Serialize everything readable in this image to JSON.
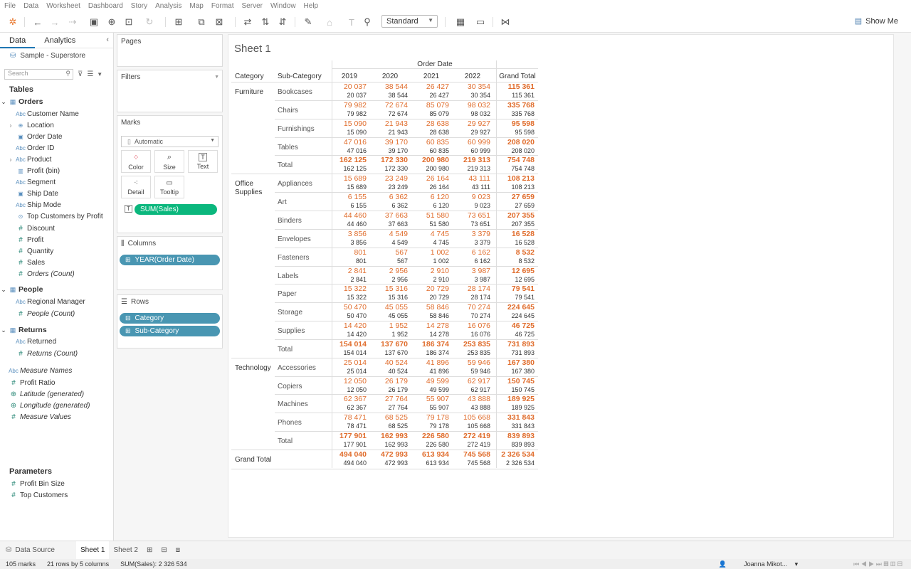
{
  "menu": [
    "File",
    "Data",
    "Worksheet",
    "Dashboard",
    "Story",
    "Analysis",
    "Map",
    "Format",
    "Server",
    "Window",
    "Help"
  ],
  "toolbar": {
    "fit_value": "Standard",
    "show_me": "Show Me"
  },
  "left_pane": {
    "tabs": [
      "Data",
      "Analytics"
    ],
    "datasource": "Sample - Superstore",
    "search_placeholder": "Search",
    "tables_title": "Tables",
    "tables": [
      {
        "name": "Orders",
        "fields": [
          {
            "label": "Customer Name",
            "type": "Abc"
          },
          {
            "label": "Location",
            "type": "geo",
            "expand": true
          },
          {
            "label": "Order Date",
            "type": "date"
          },
          {
            "label": "Order ID",
            "type": "Abc"
          },
          {
            "label": "Product",
            "type": "Abc",
            "expand": true
          },
          {
            "label": "Profit (bin)",
            "type": "bin"
          },
          {
            "label": "Segment",
            "type": "Abc"
          },
          {
            "label": "Ship Date",
            "type": "date"
          },
          {
            "label": "Ship Mode",
            "type": "Abc"
          },
          {
            "label": "Top Customers by Profit",
            "type": "set"
          },
          {
            "label": "Discount",
            "type": "#"
          },
          {
            "label": "Profit",
            "type": "#"
          },
          {
            "label": "Quantity",
            "type": "#"
          },
          {
            "label": "Sales",
            "type": "#"
          },
          {
            "label": "Orders (Count)",
            "type": "#",
            "italic": true
          }
        ]
      },
      {
        "name": "People",
        "fields": [
          {
            "label": "Regional Manager",
            "type": "Abc"
          },
          {
            "label": "People (Count)",
            "type": "#",
            "italic": true
          }
        ]
      },
      {
        "name": "Returns",
        "fields": [
          {
            "label": "Returned",
            "type": "Abc"
          },
          {
            "label": "Returns (Count)",
            "type": "#",
            "italic": true
          }
        ]
      }
    ],
    "extra_fields": [
      {
        "label": "Measure Names",
        "type": "Abc",
        "italic": true
      },
      {
        "label": "Profit Ratio",
        "type": "#"
      },
      {
        "label": "Latitude (generated)",
        "type": "globe",
        "italic": true
      },
      {
        "label": "Longitude (generated)",
        "type": "globe",
        "italic": true
      },
      {
        "label": "Measure Values",
        "type": "#",
        "italic": true
      }
    ],
    "parameters_title": "Parameters",
    "parameters": [
      "Profit Bin Size",
      "Top Customers"
    ]
  },
  "shelves": {
    "pages": "Pages",
    "filters": "Filters",
    "marks": "Marks",
    "mark_type": "Automatic",
    "mark_buttons": [
      "Color",
      "Size",
      "Text",
      "Detail",
      "Tooltip"
    ],
    "marks_pill": "SUM(Sales)",
    "columns": "Columns",
    "columns_pill": "YEAR(Order Date)",
    "rows": "Rows",
    "rows_pills": [
      "Category",
      "Sub-Category"
    ]
  },
  "sheet": {
    "title": "Sheet 1",
    "col_group": "Order Date",
    "headers": [
      "Category",
      "Sub-Category",
      "2019",
      "2020",
      "2021",
      "2022",
      "Grand Total"
    ],
    "groups": [
      {
        "category": "Furniture",
        "rows": [
          {
            "sub": "Bookcases",
            "v": [
              "20 037",
              "38 544",
              "26 427",
              "30 354",
              "115 361"
            ]
          },
          {
            "sub": "Chairs",
            "v": [
              "79 982",
              "72 674",
              "85 079",
              "98 032",
              "335 768"
            ]
          },
          {
            "sub": "Furnishings",
            "v": [
              "15 090",
              "21 943",
              "28 638",
              "29 927",
              "95 598"
            ]
          },
          {
            "sub": "Tables",
            "v": [
              "47 016",
              "39 170",
              "60 835",
              "60 999",
              "208 020"
            ]
          },
          {
            "sub": "Total",
            "v": [
              "162 125",
              "172 330",
              "200 980",
              "219 313",
              "754 748"
            ],
            "total": true
          }
        ]
      },
      {
        "category": "Office Supplies",
        "rows": [
          {
            "sub": "Appliances",
            "v": [
              "15 689",
              "23 249",
              "26 164",
              "43 111",
              "108 213"
            ]
          },
          {
            "sub": "Art",
            "v": [
              "6 155",
              "6 362",
              "6 120",
              "9 023",
              "27 659"
            ]
          },
          {
            "sub": "Binders",
            "v": [
              "44 460",
              "37 663",
              "51 580",
              "73 651",
              "207 355"
            ]
          },
          {
            "sub": "Envelopes",
            "v": [
              "3 856",
              "4 549",
              "4 745",
              "3 379",
              "16 528"
            ]
          },
          {
            "sub": "Fasteners",
            "v": [
              "801",
              "567",
              "1 002",
              "6 162",
              "8 532"
            ]
          },
          {
            "sub": "Labels",
            "v": [
              "2 841",
              "2 956",
              "2 910",
              "3 987",
              "12 695"
            ]
          },
          {
            "sub": "Paper",
            "v": [
              "15 322",
              "15 316",
              "20 729",
              "28 174",
              "79 541"
            ]
          },
          {
            "sub": "Storage",
            "v": [
              "50 470",
              "45 055",
              "58 846",
              "70 274",
              "224 645"
            ]
          },
          {
            "sub": "Supplies",
            "v": [
              "14 420",
              "1 952",
              "14 278",
              "16 076",
              "46 725"
            ]
          },
          {
            "sub": "Total",
            "v": [
              "154 014",
              "137 670",
              "186 374",
              "253 835",
              "731 893"
            ],
            "total": true
          }
        ]
      },
      {
        "category": "Technology",
        "rows": [
          {
            "sub": "Accessories",
            "v": [
              "25 014",
              "40 524",
              "41 896",
              "59 946",
              "167 380"
            ]
          },
          {
            "sub": "Copiers",
            "v": [
              "12 050",
              "26 179",
              "49 599",
              "62 917",
              "150 745"
            ]
          },
          {
            "sub": "Machines",
            "v": [
              "62 367",
              "27 764",
              "55 907",
              "43 888",
              "189 925"
            ]
          },
          {
            "sub": "Phones",
            "v": [
              "78 471",
              "68 525",
              "79 178",
              "105 668",
              "331 843"
            ]
          },
          {
            "sub": "Total",
            "v": [
              "177 901",
              "162 993",
              "226 580",
              "272 419",
              "839 893"
            ],
            "total": true
          }
        ]
      }
    ],
    "grand_total": {
      "label": "Grand Total",
      "v": [
        "494 040",
        "472 993",
        "613 934",
        "745 568",
        "2 326 534"
      ]
    }
  },
  "bottom_tabs": [
    "Data Source",
    "Sheet 1",
    "Sheet 2"
  ],
  "status": {
    "marks": "105 marks",
    "dims": "21 rows by 5 columns",
    "sum": "SUM(Sales): 2 326 534",
    "user": "Joanna Mikot..."
  }
}
